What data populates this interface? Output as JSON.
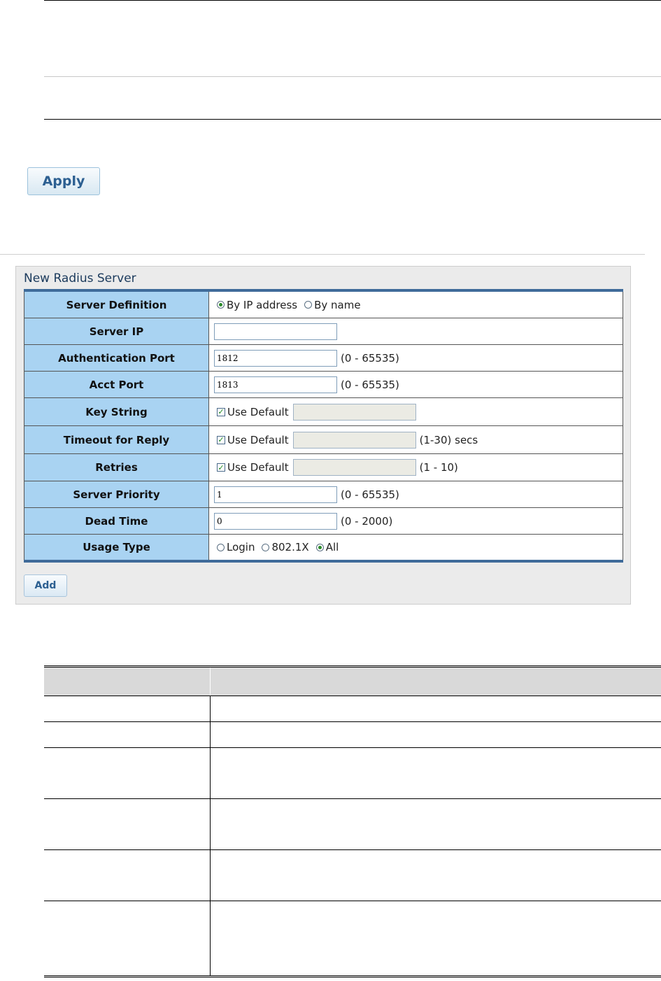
{
  "apply_label": "Apply",
  "panel": {
    "title": "New Radius Server",
    "add_label": "Add",
    "rows": {
      "server_definition": {
        "label": "Server Definition",
        "options": [
          "By IP address",
          "By name"
        ],
        "selected": "By IP address"
      },
      "server_ip": {
        "label": "Server IP",
        "value": ""
      },
      "auth_port": {
        "label": "Authentication Port",
        "value": "1812",
        "range": "(0 - 65535)"
      },
      "acct_port": {
        "label": "Acct Port",
        "value": "1813",
        "range": "(0 - 65535)"
      },
      "key_string": {
        "label": "Key String",
        "check_label": "Use Default",
        "checked": true
      },
      "timeout": {
        "label": "Timeout for Reply",
        "check_label": "Use Default",
        "checked": true,
        "range": "(1-30) secs"
      },
      "retries": {
        "label": "Retries",
        "check_label": "Use Default",
        "checked": true,
        "range": "(1 - 10)"
      },
      "priority": {
        "label": "Server Priority",
        "value": "1",
        "range": "(0 - 65535)"
      },
      "dead_time": {
        "label": "Dead Time",
        "value": "0",
        "range": "(0 - 2000)"
      },
      "usage_type": {
        "label": "Usage Type",
        "options": [
          "Login",
          "802.1X",
          "All"
        ],
        "selected": "All"
      }
    }
  },
  "colors": {
    "label_cell": "#a9d3f2",
    "table_border": "#3f6b9a",
    "button_text": "#2c5f91",
    "panel_bg": "#ebebeb"
  }
}
